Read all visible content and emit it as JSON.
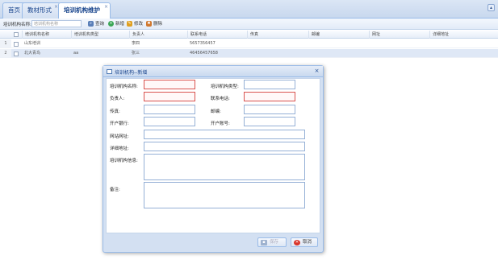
{
  "tabs": [
    {
      "label": "首页",
      "closable": false,
      "active": false
    },
    {
      "label": "教材形式",
      "closable": true,
      "active": false
    },
    {
      "label": "培训机构维护",
      "closable": true,
      "active": true
    }
  ],
  "toolbar": {
    "search_label": "培训机构名称:",
    "search_placeholder": "培训机构名称",
    "buttons": [
      {
        "label": "查询",
        "icon": "search-icon",
        "color": "#5a7fb8"
      },
      {
        "label": "新增",
        "icon": "add-icon",
        "color": "#3aa655"
      },
      {
        "label": "修改",
        "icon": "edit-icon",
        "color": "#e0a020"
      },
      {
        "label": "删除",
        "icon": "delete-icon",
        "color": "#d0782e"
      }
    ]
  },
  "grid": {
    "columns": [
      "培训机构名称",
      "培训机构类型",
      "负责人",
      "联系电话",
      "传真",
      "邮编",
      "网址",
      "详细地址"
    ],
    "rows": [
      {
        "num": "1",
        "cells": [
          "山东培训",
          "",
          "李四",
          "5657356457",
          "",
          "",
          "",
          ""
        ]
      },
      {
        "num": "2",
        "cells": [
          "北大青鸟",
          "aa",
          "张三",
          "46456457658",
          "",
          "",
          "",
          ""
        ]
      }
    ]
  },
  "dialog": {
    "title": "培训机构--新增",
    "fields": {
      "org_name": "培训机构名称:",
      "org_type": "培训机构类型:",
      "manager": "负责人:",
      "phone": "联系电话:",
      "fax": "传真:",
      "postcode": "邮编:",
      "bank": "开户银行:",
      "account": "开户账号:",
      "website": "网站网址:",
      "address": "详细地址:",
      "info": "培训机构信息:",
      "remark": "备注:"
    },
    "save_label": "保存",
    "cancel_label": "取消"
  },
  "colors": {
    "required_border": "#d9534f",
    "accent": "#15428b"
  }
}
